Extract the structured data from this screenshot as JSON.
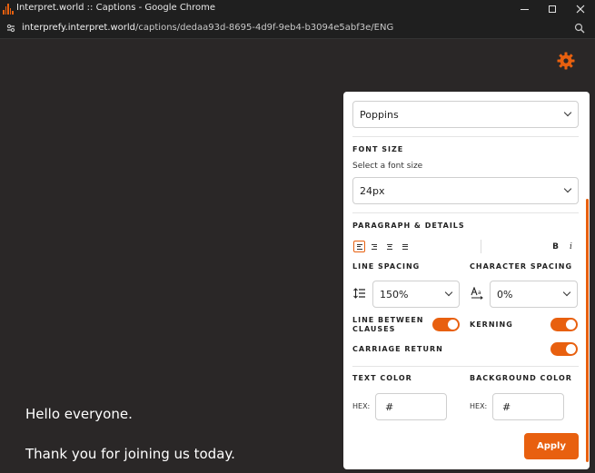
{
  "window": {
    "title": "Interpret.world :: Captions - Google Chrome"
  },
  "address_bar": {
    "url_host": "interprefy.interpret.world",
    "url_path": "/captions/dedaa93d-8695-4d9f-9eb4-b3094e5abf3e/ENG"
  },
  "captions": [
    "Hello everyone.",
    "Thank you for joining us today."
  ],
  "settings": {
    "font_family_value": "Poppins",
    "font_size": {
      "heading": "FONT SIZE",
      "hint": "Select a font size",
      "value": "24px"
    },
    "paragraph": {
      "heading": "PARAGRAPH & DETAILS",
      "bold_label": "B",
      "italic_label": "i"
    },
    "line_spacing": {
      "heading": "LINE SPACING",
      "value": "150%"
    },
    "character_spacing": {
      "heading": "CHARACTER SPACING",
      "value": "0%"
    },
    "toggles": {
      "line_between_clauses": "LINE BETWEEN CLAUSES",
      "kerning": "KERNING",
      "carriage_return": "CARRIAGE RETURN"
    },
    "text_color": {
      "heading": "TEXT COLOR",
      "hex_label": "HEX:",
      "value": "#"
    },
    "background_color": {
      "heading": "BACKGROUND COLOR",
      "hex_label": "HEX:",
      "value": "#"
    },
    "apply_label": "Apply"
  },
  "colors": {
    "accent": "#e8600f",
    "page_background": "#2a2727",
    "panel_background": "#ffffff"
  }
}
